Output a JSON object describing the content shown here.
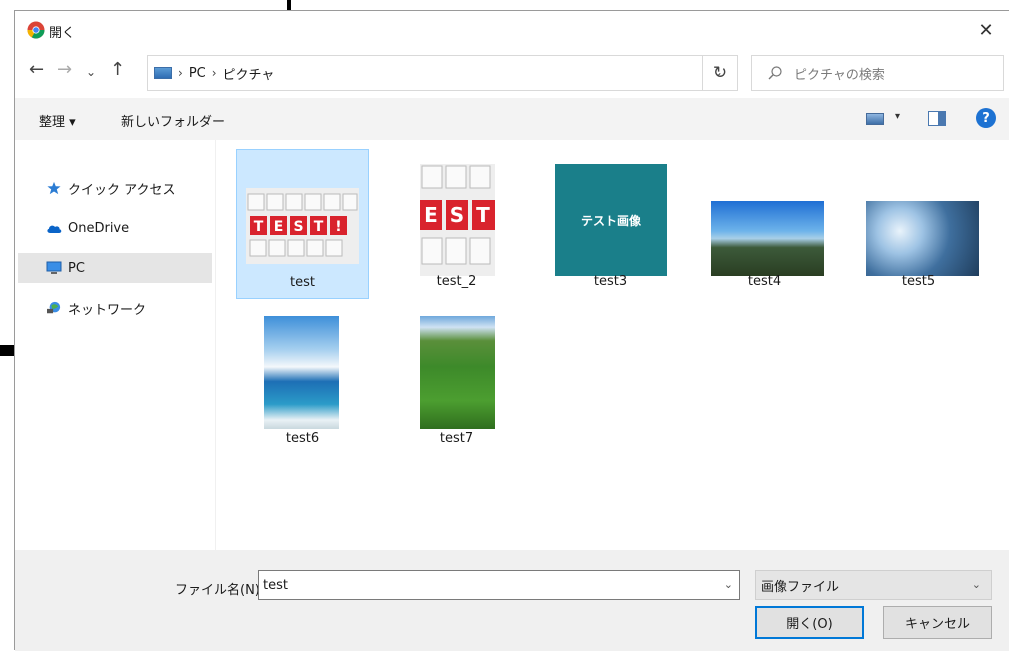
{
  "dialog": {
    "title": "開く",
    "close_glyph": "✕"
  },
  "nav": {
    "back": "←",
    "forward": "→",
    "recent": "⌄",
    "up": "↑",
    "breadcrumb": [
      "PC",
      "ピクチャ"
    ],
    "breadcrumb_sep": "›",
    "dropdown": "⌄",
    "refresh": "↻",
    "search_placeholder": "ピクチャの検索"
  },
  "toolbar": {
    "organize": "整理 ▾",
    "new_folder": "新しいフォルダー",
    "view_drop": "▾",
    "help": "?"
  },
  "sidebar": {
    "items": [
      {
        "label": "クイック アクセス",
        "icon": "star-icon"
      },
      {
        "label": "OneDrive",
        "icon": "cloud-icon"
      },
      {
        "label": "PC",
        "icon": "computer-icon",
        "selected": true
      },
      {
        "label": "ネットワーク",
        "icon": "network-icon"
      }
    ]
  },
  "files": [
    {
      "name": "test",
      "selected": true
    },
    {
      "name": "test_2"
    },
    {
      "name": "test3",
      "thumb_text": "テスト画像"
    },
    {
      "name": "test4"
    },
    {
      "name": "test5"
    },
    {
      "name": "test6"
    },
    {
      "name": "test7"
    }
  ],
  "footer": {
    "filename_label": "ファイル名(N):",
    "filename_value": "test",
    "filetype": "画像ファイル",
    "open_button": "開く(O)",
    "cancel_button": "キャンセル"
  },
  "colors": {
    "accent": "#0078d7",
    "selection": "#cce8ff",
    "teal_thumb": "#1a7f8a"
  }
}
